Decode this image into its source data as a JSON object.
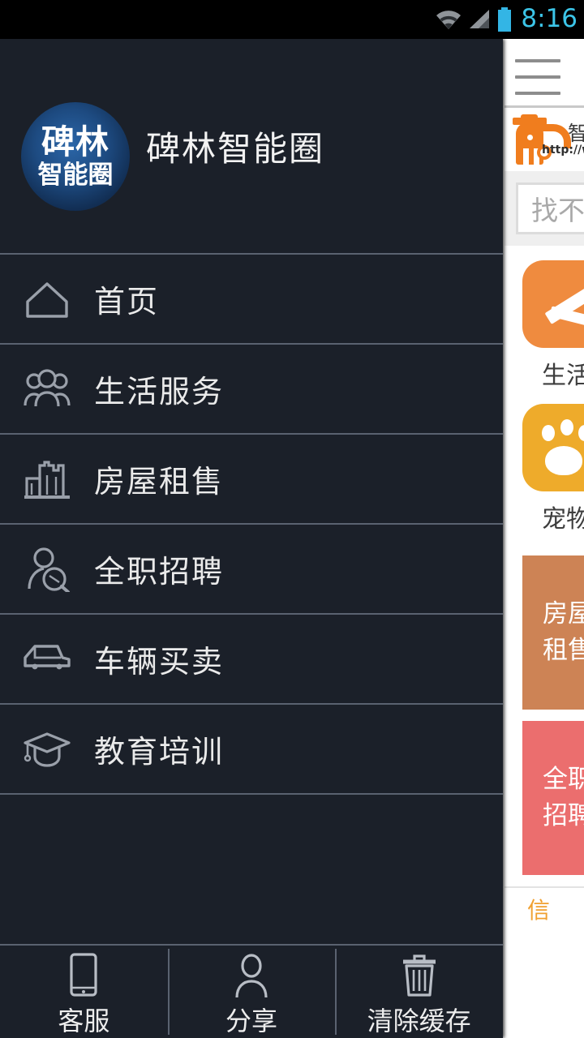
{
  "status_bar": {
    "time": "8:16",
    "icons": [
      "wifi-icon",
      "cellular-signal-icon",
      "battery-icon"
    ],
    "clock_color": "#3cc5e8",
    "battery_color": "#33b5e5",
    "background": "#000000"
  },
  "drawer": {
    "background": "#1b2029",
    "divider_color": "#5a6270",
    "logo": {
      "line1": "碑林",
      "line2": "智能圈",
      "shape": "circle",
      "gradient_from": "#2b66a8",
      "gradient_to": "#0b1a30"
    },
    "app_title": "碑林智能圈",
    "menu": [
      {
        "icon": "home-icon",
        "label": "首页"
      },
      {
        "icon": "people-group-icon",
        "label": "生活服务"
      },
      {
        "icon": "building-icon",
        "label": "房屋租售"
      },
      {
        "icon": "person-search-icon",
        "label": "全职招聘"
      },
      {
        "icon": "car-icon",
        "label": "车辆买卖"
      },
      {
        "icon": "graduation-cap-icon",
        "label": "教育培训"
      }
    ],
    "footer": [
      {
        "icon": "mobile-phone-icon",
        "label": "客服"
      },
      {
        "icon": "person-icon",
        "label": "分享"
      },
      {
        "icon": "trash-can-icon",
        "label": "清除缓存"
      }
    ]
  },
  "webpage": {
    "background": "#ffffff",
    "menu_icon": "hamburger-menu-icon",
    "brand": {
      "mascot": "orange-mascot-icon",
      "name_partial": "智",
      "url_partial": "http://www.x"
    },
    "search": {
      "placeholder": "找不"
    },
    "tiles": [
      {
        "label": "生活",
        "color": "#ef8b3f",
        "icon": "tools-icon"
      },
      {
        "label": "宠物",
        "color": "#eeab2b",
        "icon": "paw-print-icon"
      }
    ],
    "cards": [
      {
        "line1": "房屋",
        "line2": "租售",
        "color": "#cd8355"
      },
      {
        "line1": "全职",
        "line2": "招聘",
        "color": "#eb6e6e"
      }
    ],
    "footer_glyph": "信"
  }
}
